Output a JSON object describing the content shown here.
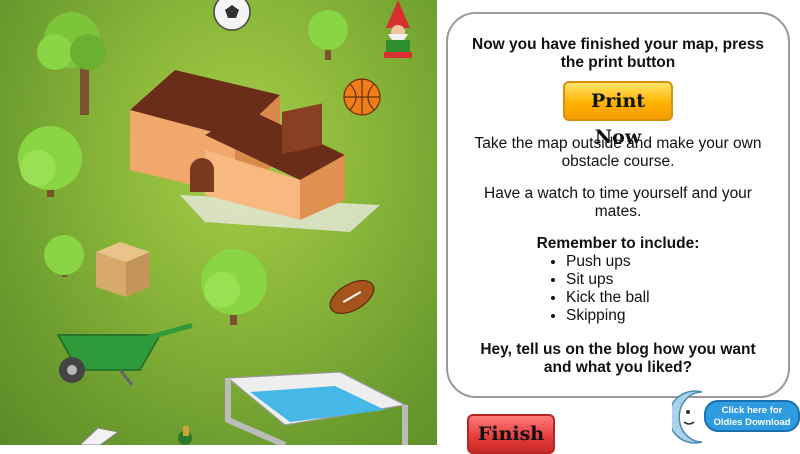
{
  "map": {
    "items": [
      "tree",
      "soccer-ball",
      "garden-gnome",
      "house",
      "basketball",
      "cardboard-box",
      "rugby-ball",
      "wheelbarrow",
      "swimming-pool",
      "skateboard"
    ]
  },
  "panel": {
    "heading": "Now you have finished your map, press the print button",
    "print_label": "Print Now",
    "para1": "Take the map outside and make your own obstacle course.",
    "para2": "Have a watch to time yourself and your mates.",
    "remember_heading": "Remember to include:",
    "list": [
      "Push ups",
      "Sit ups",
      "Kick the ball",
      "Skipping"
    ],
    "closing": "Hey, tell us on the blog how you want and what you liked?"
  },
  "finish_label": "Finish",
  "oldies": {
    "line1": "Click here for",
    "line2": "Oldies Download"
  },
  "colors": {
    "grass": "#8cb83a",
    "print_button": "#ffb300",
    "finish_button": "#e63a3a",
    "badge": "#2f9be0"
  }
}
